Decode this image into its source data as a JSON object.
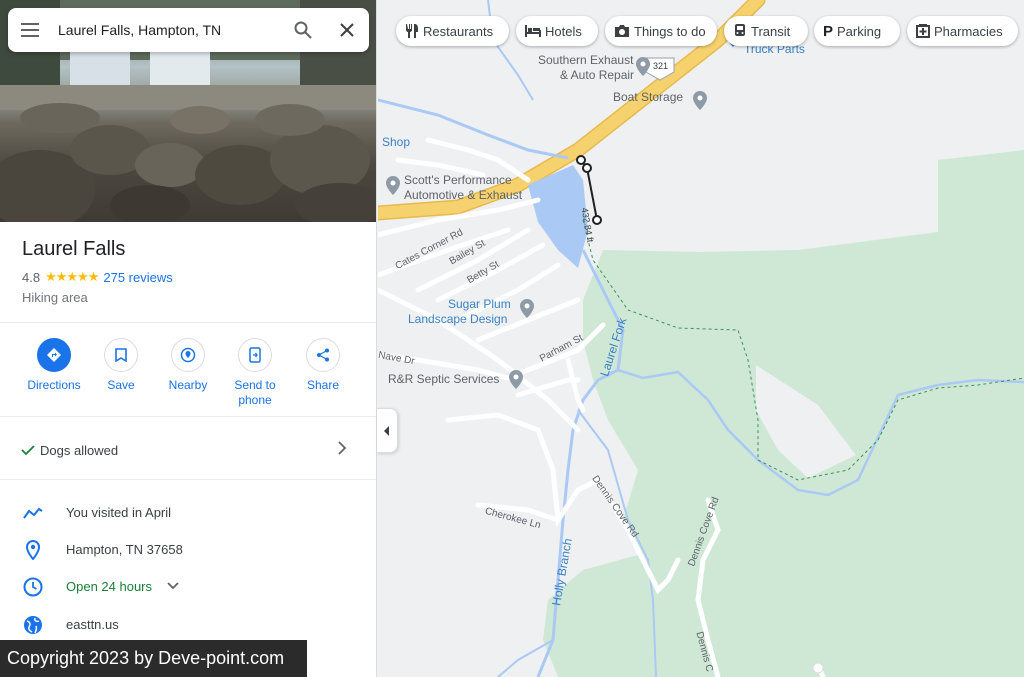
{
  "search": {
    "query": "Laurel Falls, Hampton, TN"
  },
  "place": {
    "title": "Laurel Falls",
    "rating": "4.8",
    "stars": "★★★★★",
    "reviews": "275 reviews",
    "category": "Hiking area"
  },
  "actions": {
    "directions": "Directions",
    "save": "Save",
    "nearby": "Nearby",
    "send_to_phone": "Send to phone",
    "share": "Share"
  },
  "amenity": {
    "dogs": "Dogs allowed"
  },
  "info": {
    "visited": "You visited in April",
    "address": "Hampton, TN 37658",
    "hours": "Open 24 hours",
    "website": "easttn.us"
  },
  "copyright": "Copyright 2023 by Deve-point.com",
  "chips": {
    "restaurants": "Restaurants",
    "hotels": "Hotels",
    "things_to_do": "Things to do",
    "transit": "Transit",
    "parking": "Parking",
    "pharmacies": "Pharmacies"
  },
  "map_labels": {
    "truck_parts": "Truck Parts",
    "southern_exhaust": "Southern Exhaust",
    "auto_repair": "& Auto Repair",
    "boat_storage": "Boat Storage",
    "shop": "Shop",
    "scotts_1": "Scott's Performance",
    "scotts_2": "Automotive & Exhaust",
    "cates_corner": "Cates Corner Rd",
    "bailey": "Bailey St",
    "betty": "Betty St",
    "sugar_plum_1": "Sugar Plum",
    "sugar_plum_2": "Landscape Design",
    "parham": "Parham St",
    "nave": "Nave Dr",
    "rr_septic": "R&R Septic Services",
    "laurel_fork": "Laurel Fork",
    "cherokee": "Cherokee Ln",
    "dennis_cove_1": "Dennis Cove Rd",
    "dennis_cove_2": "Dennis Cove Rd",
    "dennis_cove_3": "Dennis C",
    "holly_branch": "Holly Branch",
    "measure": "432.84 ft",
    "route_321": "321"
  },
  "colors": {
    "accent": "#1a73e8",
    "park_green": "#cfe8d5",
    "water": "#aac9f4",
    "highway": "#f6d26e",
    "star": "#fbbc04"
  }
}
